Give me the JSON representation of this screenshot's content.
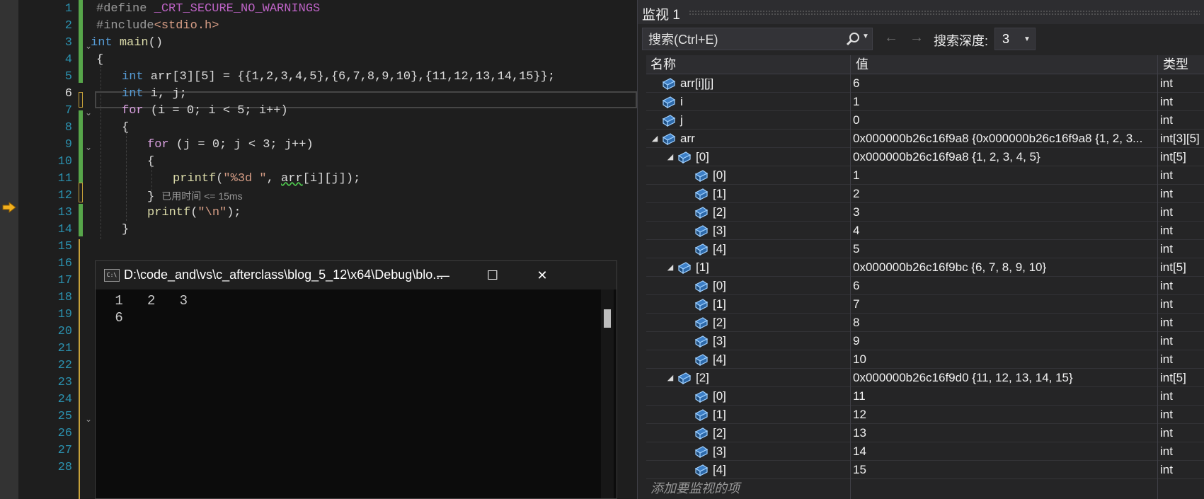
{
  "editor": {
    "current_line": 6,
    "line_numbers": [
      "1",
      "2",
      "3",
      "4",
      "5",
      "6",
      "7",
      "8",
      "9",
      "10",
      "11",
      "12",
      "13",
      "14",
      "15",
      "16",
      "17",
      "18",
      "19",
      "20",
      "21",
      "22",
      "23",
      "24",
      "25",
      "26",
      "27",
      "28"
    ],
    "code": {
      "l1_pp": "#define",
      "l1_mac": "_CRT_SECURE_NO_WARNINGS",
      "l2_pp": "#include",
      "l2_inc": "<stdio.h>",
      "l3_kw": "int",
      "l3_fn": "main",
      "l3_rest": "()",
      "l4": "{",
      "l5_kw": "int",
      "l5_rest": " arr[3][5] = {{1,2,3,4,5},{6,7,8,9,10},{11,12,13,14,15}};",
      "l6_kw": "int",
      "l6_rest": " i, j;",
      "l7_ctl": "for",
      "l7_rest": " (i = 0; i < 5; i++)",
      "l8": "{",
      "l9_ctl": "for",
      "l9_rest": " (j = 0; j < 3; j++)",
      "l10": "{",
      "l11_fn": "printf",
      "l11_open": "(",
      "l11_str": "\"%3d \"",
      "l11_comma": ", ",
      "l11_squig": "arr",
      "l11_idx": "[i][j]",
      "l11_close": ");",
      "l12": "}",
      "l12_hint": "已用时间 <= 15ms",
      "l13_fn": "printf",
      "l13_open": "(",
      "l13_str": "\"\\n\"",
      "l13_close": ");",
      "l14": "}"
    }
  },
  "console": {
    "title": "D:\\code_and\\vs\\c_afterclass\\blog_5_12\\x64\\Debug\\blo...",
    "icon": "C:\\",
    "minimize": "—",
    "maximize": "☐",
    "close": "✕",
    "output": " 1   2   3\n 6"
  },
  "watch": {
    "title": "监视 1",
    "search_placeholder": "搜索(Ctrl+E)",
    "depth_label": "搜索深度:",
    "depth_value": "3",
    "columns": {
      "name": "名称",
      "value": "值",
      "type": "类型"
    },
    "rows": [
      {
        "name": "arr[i][j]",
        "value": "6",
        "type": "int",
        "level": 0,
        "expander": ""
      },
      {
        "name": "i",
        "value": "1",
        "type": "int",
        "level": 0,
        "expander": ""
      },
      {
        "name": "j",
        "value": "0",
        "type": "int",
        "level": 0,
        "expander": ""
      },
      {
        "name": "arr",
        "value": "0x000000b26c16f9a8 {0x000000b26c16f9a8 {1, 2, 3...",
        "type": "int[3][5]",
        "level": 0,
        "expander": "◢"
      },
      {
        "name": "[0]",
        "value": "0x000000b26c16f9a8 {1, 2, 3, 4, 5}",
        "type": "int[5]",
        "level": 1,
        "expander": "◢"
      },
      {
        "name": "[0]",
        "value": "1",
        "type": "int",
        "level": 2,
        "expander": ""
      },
      {
        "name": "[1]",
        "value": "2",
        "type": "int",
        "level": 2,
        "expander": ""
      },
      {
        "name": "[2]",
        "value": "3",
        "type": "int",
        "level": 2,
        "expander": ""
      },
      {
        "name": "[3]",
        "value": "4",
        "type": "int",
        "level": 2,
        "expander": ""
      },
      {
        "name": "[4]",
        "value": "5",
        "type": "int",
        "level": 2,
        "expander": ""
      },
      {
        "name": "[1]",
        "value": "0x000000b26c16f9bc {6, 7, 8, 9, 10}",
        "type": "int[5]",
        "level": 1,
        "expander": "◢"
      },
      {
        "name": "[0]",
        "value": "6",
        "type": "int",
        "level": 2,
        "expander": ""
      },
      {
        "name": "[1]",
        "value": "7",
        "type": "int",
        "level": 2,
        "expander": ""
      },
      {
        "name": "[2]",
        "value": "8",
        "type": "int",
        "level": 2,
        "expander": ""
      },
      {
        "name": "[3]",
        "value": "9",
        "type": "int",
        "level": 2,
        "expander": ""
      },
      {
        "name": "[4]",
        "value": "10",
        "type": "int",
        "level": 2,
        "expander": ""
      },
      {
        "name": "[2]",
        "value": "0x000000b26c16f9d0 {11, 12, 13, 14, 15}",
        "type": "int[5]",
        "level": 1,
        "expander": "◢"
      },
      {
        "name": "[0]",
        "value": "11",
        "type": "int",
        "level": 2,
        "expander": ""
      },
      {
        "name": "[1]",
        "value": "12",
        "type": "int",
        "level": 2,
        "expander": ""
      },
      {
        "name": "[2]",
        "value": "13",
        "type": "int",
        "level": 2,
        "expander": ""
      },
      {
        "name": "[3]",
        "value": "14",
        "type": "int",
        "level": 2,
        "expander": ""
      },
      {
        "name": "[4]",
        "value": "15",
        "type": "int",
        "level": 2,
        "expander": ""
      }
    ],
    "add_item_placeholder": "添加要监视的项"
  }
}
